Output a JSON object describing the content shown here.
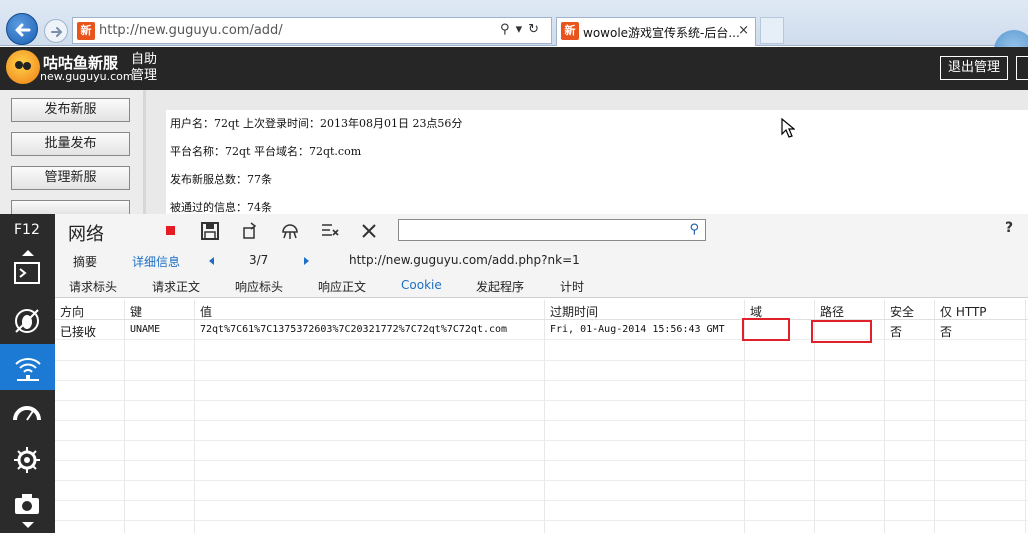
{
  "browser": {
    "address_url": "http://new.guguyu.com/add/",
    "tab_title": "wowole游戏宣传系统-后台...",
    "favicon_char": "新",
    "accent": "#1a5fb4"
  },
  "site": {
    "logo_name": "咕咕鱼新服",
    "logo_domain": "new.guguyu.com",
    "logo_sub": "自助管理",
    "logout_label": "退出管理",
    "menu": [
      "发布新服",
      "批量发布",
      "管理新服"
    ],
    "info": {
      "user_line": "用户名：72qt  上次登录时间：2013年08月01日 23点56分",
      "platform_line": "平台名称：72qt  平台域名：72qt.com",
      "published_line": "发布新服总数：77条",
      "approved_line": "被通过的信息：74条"
    }
  },
  "devtools": {
    "f12_label": "F12",
    "panel_title": "网络",
    "help": "?",
    "nav1": {
      "summary": "摘要",
      "details": "详细信息",
      "counter": "3/7",
      "url": "http://new.guguyu.com/add.php?nk=1"
    },
    "nav2": [
      "请求标头",
      "请求正文",
      "响应标头",
      "响应正文",
      "Cookie",
      "发起程序",
      "计时"
    ],
    "active_subtab_color": "#1c6fc4",
    "columns": [
      "方向",
      "键",
      "值",
      "过期时间",
      "域",
      "路径",
      "安全",
      "仅 HTTP"
    ],
    "cookie_row": {
      "direction": "已接收",
      "key": "UNAME",
      "value": "72qt%7C61%7C1375372603%7C20321772%7C72qt%7C72qt.com",
      "expires": "Fri, 01-Aug-2014 15:56:43 GMT",
      "domain": "",
      "path": "",
      "secure": "否",
      "http_only": "否"
    },
    "highlight_color": "#e0202a"
  }
}
